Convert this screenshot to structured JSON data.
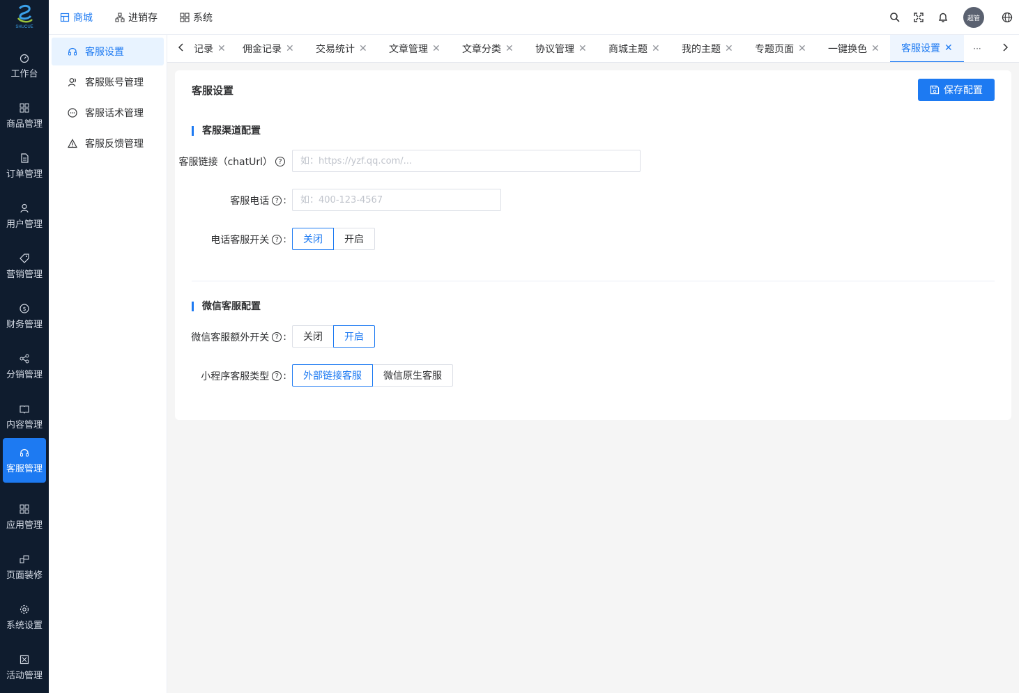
{
  "logo": {
    "text": "SHUCUE"
  },
  "sidebar": {
    "items": [
      {
        "label": "工作台",
        "icon": "dashboard-icon"
      },
      {
        "label": "商品管理",
        "icon": "grid-icon"
      },
      {
        "label": "订单管理",
        "icon": "document-icon"
      },
      {
        "label": "用户管理",
        "icon": "user-icon"
      },
      {
        "label": "营销管理",
        "icon": "tag-icon"
      },
      {
        "label": "财务管理",
        "icon": "dollar-icon"
      },
      {
        "label": "分销管理",
        "icon": "share-icon"
      },
      {
        "label": "内容管理",
        "icon": "book-icon"
      },
      {
        "label": "客服管理",
        "icon": "headset-icon",
        "active": true
      },
      {
        "label": "应用管理",
        "icon": "apps-icon"
      },
      {
        "label": "页面装修",
        "icon": "layout-icon"
      },
      {
        "label": "系统设置",
        "icon": "gear-icon"
      },
      {
        "label": "活动管理",
        "icon": "activity-icon"
      }
    ]
  },
  "submenu": {
    "items": [
      {
        "label": "客服设置",
        "icon": "headset-icon",
        "active": true
      },
      {
        "label": "客服账号管理",
        "icon": "users-icon"
      },
      {
        "label": "客服话术管理",
        "icon": "chat-icon"
      },
      {
        "label": "客服反馈管理",
        "icon": "warning-icon"
      }
    ]
  },
  "header": {
    "nav": [
      {
        "label": "商城",
        "icon": "store-icon",
        "active": true
      },
      {
        "label": "进销存",
        "icon": "network-icon"
      },
      {
        "label": "系统",
        "icon": "system-icon"
      }
    ],
    "avatar_text": "超管"
  },
  "tabs": {
    "items": [
      {
        "label": "记录",
        "active": false
      },
      {
        "label": "佣金记录",
        "active": false
      },
      {
        "label": "交易统计",
        "active": false
      },
      {
        "label": "文章管理",
        "active": false
      },
      {
        "label": "文章分类",
        "active": false
      },
      {
        "label": "协议管理",
        "active": false
      },
      {
        "label": "商城主题",
        "active": false
      },
      {
        "label": "我的主题",
        "active": false
      },
      {
        "label": "专题页面",
        "active": false
      },
      {
        "label": "一键换色",
        "active": false
      },
      {
        "label": "客服设置",
        "active": true
      }
    ],
    "more": "···"
  },
  "page": {
    "title": "客服设置",
    "save_label": "保存配置",
    "section1": {
      "title": "客服渠道配置",
      "chat_url_label": "客服链接（chatUrl）",
      "chat_url_placeholder": "如：https://yzf.qq.com/...",
      "chat_url_value": "",
      "phone_label": "客服电话",
      "phone_placeholder": "如：400-123-4567",
      "phone_value": "",
      "phone_switch_label": "电话客服开关",
      "phone_switch_options": [
        "关闭",
        "开启"
      ],
      "phone_switch_selected": "关闭"
    },
    "section2": {
      "title": "微信客服配置",
      "wx_switch_label": "微信客服额外开关",
      "wx_switch_options": [
        "关闭",
        "开启"
      ],
      "wx_switch_selected": "开启",
      "mp_type_label": "小程序客服类型",
      "mp_type_options": [
        "外部链接客服",
        "微信原生客服"
      ],
      "mp_type_selected": "外部链接客服"
    }
  },
  "colors": {
    "accent": "#1d7af2",
    "sidebar_bg": "#0f1c2e",
    "page_bg": "#f5f5f5"
  }
}
